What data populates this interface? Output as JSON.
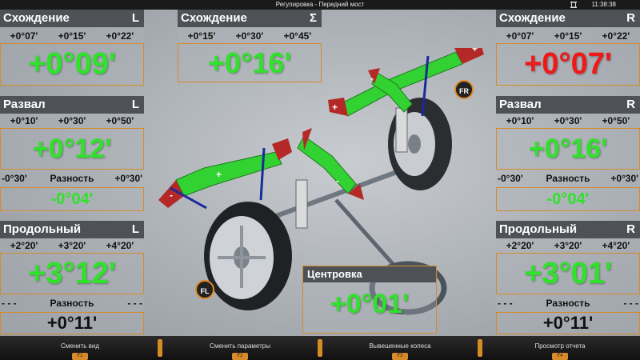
{
  "titlebar": {
    "title": "Регулировка - Передний мост",
    "clock": "11:38:38"
  },
  "panels": {
    "toe_left": {
      "name": "Схождение",
      "side": "L",
      "limits": [
        "+0°07'",
        "+0°15'",
        "+0°22'"
      ],
      "value": "+0°09'",
      "value_color": "green"
    },
    "toe_total": {
      "name": "Схождение",
      "side": "Σ",
      "limits": [
        "+0°15'",
        "+0°30'",
        "+0°45'"
      ],
      "value": "+0°16'",
      "value_color": "green"
    },
    "toe_right": {
      "name": "Схождение",
      "side": "R",
      "limits": [
        "+0°07'",
        "+0°15'",
        "+0°22'"
      ],
      "value": "+0°07'",
      "value_color": "red"
    },
    "camber_left": {
      "name": "Развал",
      "side": "L",
      "limits": [
        "+0°10'",
        "+0°30'",
        "+0°50'"
      ],
      "value": "+0°12'",
      "value_color": "green",
      "diff": {
        "min": "-0°30'",
        "label": "Разность",
        "max": "+0°30'",
        "value": "-0°04'"
      }
    },
    "camber_right": {
      "name": "Развал",
      "side": "R",
      "limits": [
        "+0°10'",
        "+0°30'",
        "+0°50'"
      ],
      "value": "+0°16'",
      "value_color": "green",
      "diff": {
        "min": "-0°30'",
        "label": "Разность",
        "max": "+0°30'",
        "value": "-0°04'"
      }
    },
    "caster_left": {
      "name": "Продольный",
      "side": "L",
      "limits": [
        "+2°20'",
        "+3°20'",
        "+4°20'"
      ],
      "value": "+3°12'",
      "value_color": "green",
      "diff": {
        "min": "- - -",
        "label": "Разность",
        "max": "- - -",
        "value": "+0°11'"
      }
    },
    "caster_right": {
      "name": "Продольный",
      "side": "R",
      "limits": [
        "+2°20'",
        "+3°20'",
        "+4°20'"
      ],
      "value": "+3°01'",
      "value_color": "green",
      "diff": {
        "min": "- - -",
        "label": "Разность",
        "max": "- - -",
        "value": "+0°11'"
      }
    }
  },
  "center": {
    "title": "Центровка",
    "value": "+0°01'"
  },
  "badges": {
    "fl": "FL",
    "fr": "FR"
  },
  "gauge_marks": {
    "plus": "+",
    "minus": "-"
  },
  "footer": [
    {
      "label": "Сменить вид",
      "key": "F1"
    },
    {
      "label": "Сменить параметры",
      "key": "F2"
    },
    {
      "label": "Вывешенные колеса",
      "key": "F3"
    },
    {
      "label": "Просмотр отчета",
      "key": "F4"
    }
  ]
}
